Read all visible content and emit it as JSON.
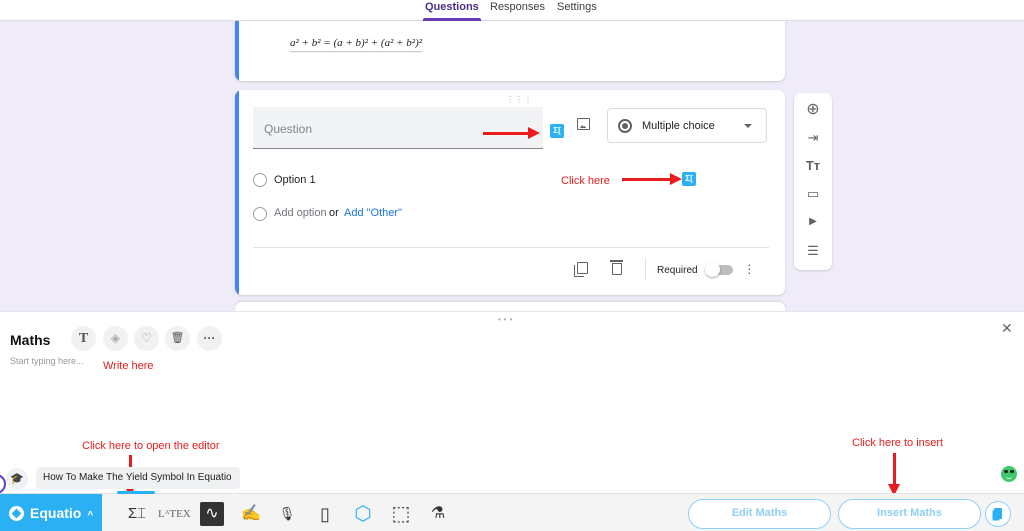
{
  "tabs": [
    {
      "label": "Questions",
      "active": true
    },
    {
      "label": "Responses",
      "active": false
    },
    {
      "label": "Settings",
      "active": false
    }
  ],
  "equation_card": {
    "equation": "a² + b² = (a + b)² + (a² + b²)²"
  },
  "question_card": {
    "question_placeholder": "Question",
    "question_type": "Multiple choice",
    "options": [
      "Option 1"
    ],
    "add_option": "Add option",
    "or_text": "or",
    "add_other": "Add \"Other\"",
    "required_label": "Required",
    "required": false,
    "equatio_icon_glyph": "Σ[",
    "icons": [
      "equatio-insert-icon",
      "image-icon",
      "radio-icon",
      "dropdown-caret-icon",
      "copy-icon",
      "delete-icon",
      "more-vert-icon"
    ]
  },
  "side_toolbar": {
    "tools": [
      {
        "name": "add-question",
        "glyph": "⊕"
      },
      {
        "name": "import-questions",
        "glyph": "⇥"
      },
      {
        "name": "add-title",
        "glyph": "Tт"
      },
      {
        "name": "add-image",
        "glyph": "▭"
      },
      {
        "name": "add-video",
        "glyph": "▶"
      },
      {
        "name": "add-section",
        "glyph": "☰"
      }
    ]
  },
  "annotations": {
    "click_here": "Click here",
    "write_here": "Write here",
    "open_editor": "Click here to open the editor",
    "insert": "Click here to insert",
    "accent_color": "#e81c1c"
  },
  "equatio_panel": {
    "title": "Maths",
    "placeholder": "Start typing here...",
    "format_buttons": [
      {
        "name": "text-style",
        "glyph": "T"
      },
      {
        "name": "fill-color",
        "glyph": "◈"
      },
      {
        "name": "favorite",
        "glyph": "♡"
      },
      {
        "name": "delete",
        "glyph": "🗑"
      },
      {
        "name": "more",
        "glyph": "···"
      }
    ],
    "close_glyph": "✕",
    "prediction": "How To Make The Yield Symbol In Equatio",
    "prediction_icon": "🎓"
  },
  "bottombar": {
    "brand": "Equatio",
    "brand_caret": "^",
    "tools": [
      {
        "name": "math-editor",
        "glyph": "Σ⌶"
      },
      {
        "name": "latex-editor",
        "glyph": "LᴬTEX"
      },
      {
        "name": "graph-editor",
        "glyph": "∿"
      },
      {
        "name": "handwriting",
        "glyph": "✍"
      },
      {
        "name": "speech-input",
        "glyph": "🎙"
      },
      {
        "name": "mobile",
        "glyph": "▯"
      },
      {
        "name": "3d-mathspace",
        "glyph": "⬡"
      },
      {
        "name": "screenshot-reader",
        "glyph": "⬚"
      },
      {
        "name": "chemistry",
        "glyph": "⚗"
      }
    ],
    "edit_button": "Edit Maths",
    "insert_button": "Insert Maths",
    "brand_color": "#2ab0f3"
  }
}
